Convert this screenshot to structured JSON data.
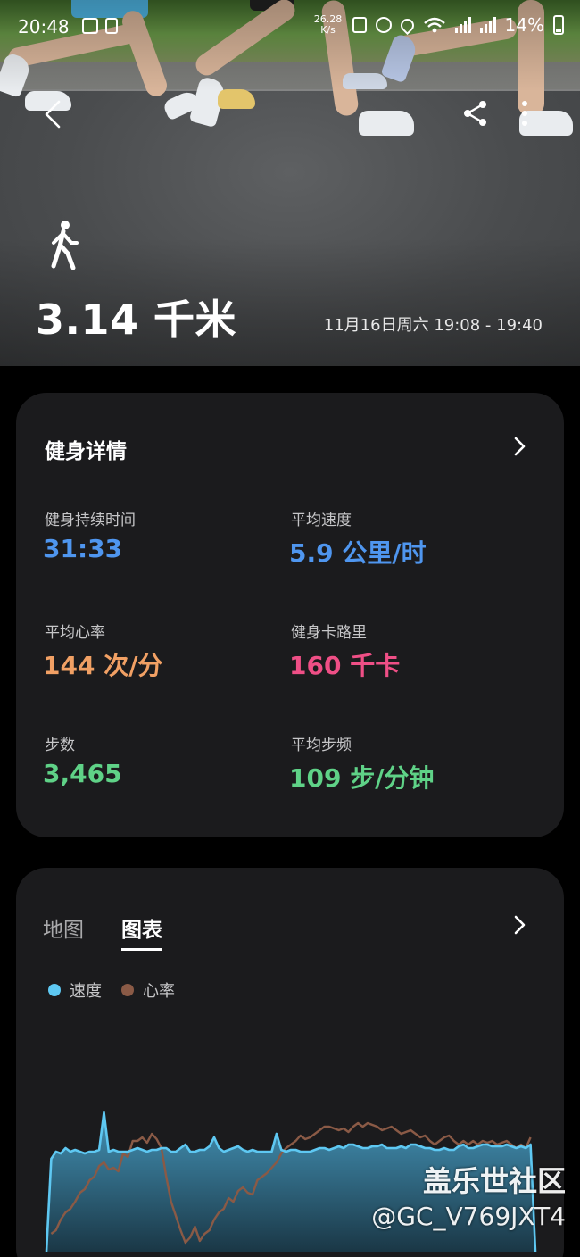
{
  "status_bar": {
    "time": "20:48",
    "net_speed_value": "26.28",
    "net_speed_unit": "K/s",
    "battery": "14%"
  },
  "hero": {
    "distance": "3.14 千米",
    "datetime": "11月16日周六 19:08 - 19:40",
    "activity_icon": "walk-icon"
  },
  "details_card": {
    "title": "健身详情",
    "stats": [
      {
        "label": "健身持续时间",
        "value": "31:33",
        "color": "#4f96ef"
      },
      {
        "label": "平均速度",
        "value": "5.9 公里/时",
        "color": "#4f96ef"
      },
      {
        "label": "平均心率",
        "value": "144 次/分",
        "color": "#f1a064"
      },
      {
        "label": "健身卡路里",
        "value": "160 千卡",
        "color": "#ef4f86"
      },
      {
        "label": "步数",
        "value": "3,465",
        "color": "#5fd287"
      },
      {
        "label": "平均步频",
        "value": "109 步/分钟",
        "color": "#5fd287"
      }
    ]
  },
  "chart_card": {
    "tabs": [
      {
        "label": "地图"
      },
      {
        "label": "图表"
      }
    ],
    "active_tab": "图表",
    "legend": [
      {
        "label": "速度",
        "color": "#5ec8f2"
      },
      {
        "label": "心率",
        "color": "#8a5a46"
      }
    ]
  },
  "chart_data": {
    "type": "line",
    "series": [
      {
        "name": "速度",
        "color": "#5ec8f2",
        "values": [
          0,
          52,
          56,
          55,
          58,
          56,
          57,
          56,
          55,
          56,
          56,
          57,
          78,
          56,
          57,
          56,
          56,
          56,
          57,
          58,
          57,
          56,
          57,
          57,
          58,
          58,
          56,
          56,
          58,
          60,
          56,
          56,
          57,
          57,
          59,
          64,
          58,
          56,
          57,
          58,
          59,
          57,
          56,
          57,
          56,
          56,
          56,
          56,
          66,
          57,
          56,
          57,
          57,
          56,
          56,
          56,
          57,
          58,
          58,
          57,
          58,
          59,
          58,
          60,
          60,
          59,
          58,
          58,
          59,
          59,
          60,
          58,
          58,
          58,
          59,
          58,
          60,
          60,
          59,
          58,
          58,
          57,
          57,
          58,
          57,
          57,
          59,
          60,
          58,
          58,
          59,
          60,
          60,
          59,
          59,
          59,
          60,
          59,
          58,
          59,
          58,
          60,
          0
        ]
      },
      {
        "name": "心率",
        "color": "#8a5a46",
        "values": [
          null,
          10,
          12,
          18,
          22,
          24,
          28,
          33,
          35,
          40,
          42,
          48,
          50,
          46,
          47,
          45,
          55,
          53,
          62,
          62,
          64,
          61,
          66,
          63,
          58,
          42,
          28,
          20,
          12,
          5,
          8,
          14,
          6,
          10,
          12,
          18,
          22,
          24,
          30,
          28,
          34,
          36,
          33,
          32,
          40,
          42,
          44,
          47,
          50,
          55,
          58,
          60,
          62,
          65,
          63,
          64,
          66,
          68,
          70,
          70,
          69,
          68,
          69,
          67,
          70,
          72,
          70,
          72,
          71,
          70,
          68,
          69,
          70,
          68,
          66,
          67,
          68,
          66,
          64,
          65,
          62,
          60,
          62,
          64,
          65,
          62,
          60,
          62,
          60,
          62,
          60,
          62,
          61,
          62,
          60,
          61,
          62,
          60,
          58,
          60,
          58,
          64,
          null
        ]
      }
    ]
  },
  "watermark": {
    "line1": "盖乐世社区",
    "line2": "@GC_V769JXT4"
  }
}
